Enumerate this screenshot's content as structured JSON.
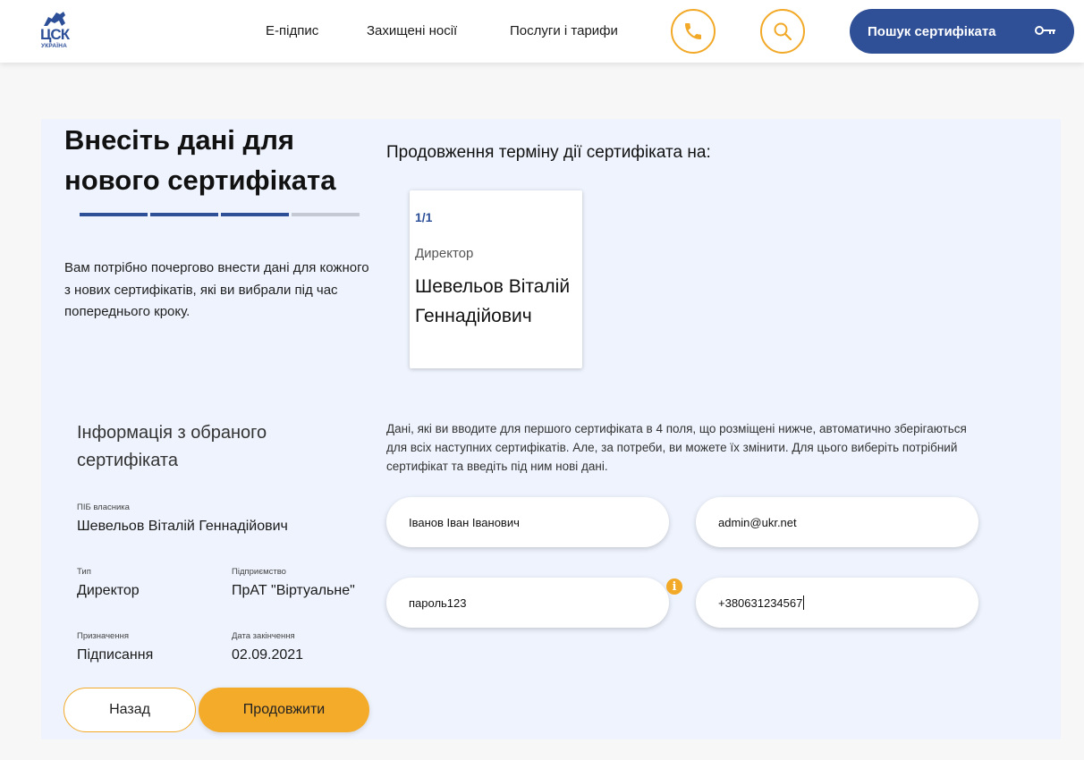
{
  "header": {
    "logo_text": "ЦСК",
    "logo_sub": "УКРАЇНА",
    "nav": [
      "Е-підпис",
      "Захищені носії",
      "Послуги і тарифи"
    ],
    "cert_search_label": "Пошук сертифіката"
  },
  "colors": {
    "accent": "#f2a927",
    "brand": "#2f4f97",
    "panel_bg": "#eef3fd"
  },
  "page": {
    "title": "Внесіть дані для нового сертифіката",
    "progress": {
      "completed_steps": 3,
      "total_steps": 4
    },
    "intro": "Вам потрібно почергово внести дані для кожного з нових сертифікатів, які ви вибрали під час попереднього кроку."
  },
  "extension": {
    "title": "Продовження терміну дії сертифіката на:",
    "card": {
      "counter": "1/1",
      "role": "Директор",
      "name": "Шевельов Віталій Геннадійович"
    }
  },
  "info": {
    "title": "Інформація з обраного сертифіката",
    "owner_label": "ПІБ власника",
    "owner_value": "Шевельов Віталій Геннадійович",
    "type_label": "Тип",
    "type_value": "Директор",
    "company_label": "Підприємство",
    "company_value": "ПрАТ \"Віртуальне\"",
    "purpose_label": "Призначення",
    "purpose_value": "Підписання",
    "expiry_label": "Дата закінчення",
    "expiry_value": "02.09.2021"
  },
  "form": {
    "note": "Дані, які ви вводите для першого сертифіката в 4 поля, що розміщені нижче, автоматично зберігаються для всіх наступних сертифікатів. Але, за потреби, ви можете їх змінити. Для цього виберіть потрібний сертифікат та введіть під ним нові дані.",
    "name_value": "Іванов Іван Іванович",
    "email_value": "admin@ukr.net",
    "password_value": "пароль123",
    "phone_value": "+380631234567",
    "info_icon": "i"
  },
  "buttons": {
    "back": "Назад",
    "next": "Продовжити"
  }
}
